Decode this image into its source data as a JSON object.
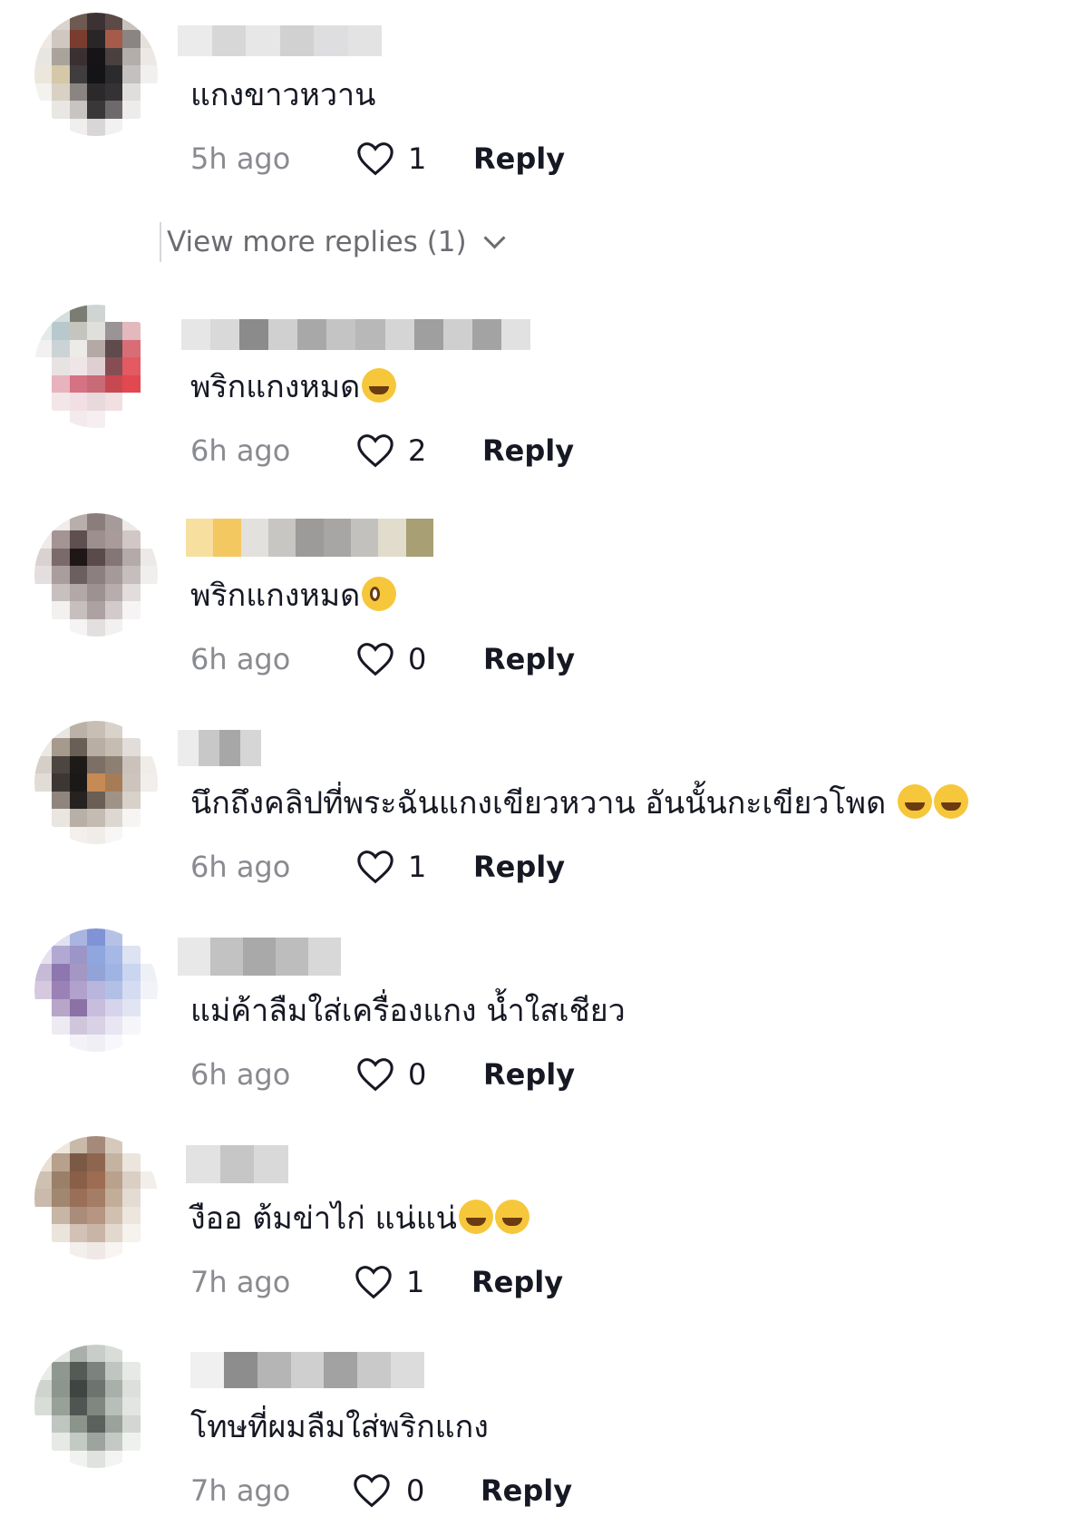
{
  "comments": [
    {
      "text": "แกงขาวหวาน",
      "emojis": [],
      "time": "5h ago",
      "likes": "1",
      "reply_label": "Reply",
      "avatar_colors": [
        "#ffffff",
        "#d9d4cf",
        "#6d5b52",
        "#3d3233",
        "#5b4a48",
        "#c8c2bc",
        "#ffffff",
        "#efe9e5",
        "#cfc7c0",
        "#7a3c2f",
        "#2a2526",
        "#a65b4a",
        "#8a8483",
        "#e4e0dc",
        "#e7e6e1",
        "#a9a39b",
        "#3a3031",
        "#161416",
        "#49403f",
        "#b3aeaa",
        "#ece8e5",
        "#ece7dc",
        "#d4c8a9",
        "#3f3d3e",
        "#141315",
        "#2b2a2c",
        "#c4c0bf",
        "#f2f0ef",
        "#f4f2ee",
        "#d9d1c4",
        "#8b8582",
        "#2b2929",
        "#343234",
        "#e0dddd",
        "#ffffff",
        "#ffffff",
        "#e9e7e4",
        "#c8c4c2",
        "#3a3739",
        "#6e6a6c",
        "#eeeceb",
        "#ffffff",
        "#ffffff",
        "#ffffff",
        "#f0efee",
        "#d8d6d7",
        "#f2f1f1",
        "#ffffff",
        "#ffffff"
      ]
    },
    {
      "text": "พริกแกงหมด",
      "emojis": [
        "laugh"
      ],
      "time": "6h ago",
      "likes": "2",
      "reply_label": "Reply",
      "avatar_colors": [
        "#ffffff",
        "#d6dfdd",
        "#7c7d72",
        "#cfd5d3",
        "#ffffff",
        "#ffffff",
        "#ffffff",
        "#e3eaea",
        "#b8c9cd",
        "#c5c5bf",
        "#dfe0dc",
        "#9a9497",
        "#e3b9bd",
        "#ffffff",
        "#f3f1f0",
        "#cbd3d6",
        "#ecebe8",
        "#b5a9a6",
        "#5f4a4c",
        "#d96d76",
        "#ffffff",
        "#ffffff",
        "#e6e3e2",
        "#f0e5e6",
        "#e0cfd2",
        "#864e54",
        "#e35a63",
        "#ffffff",
        "#ffffff",
        "#e8b3bd",
        "#d57283",
        "#c96a77",
        "#c84852",
        "#e2484f",
        "#ffffff",
        "#ffffff",
        "#f3e6e8",
        "#f2dfe3",
        "#e8d9dc",
        "#f1dfe1",
        "#ffffff",
        "#ffffff",
        "#ffffff",
        "#ffffff",
        "#f3eaec",
        "#f6eef0",
        "#ffffff",
        "#ffffff",
        "#ffffff"
      ]
    },
    {
      "text": "พริกแกงหมด",
      "emojis": [
        "plead"
      ],
      "time": "6h ago",
      "likes": "0",
      "reply_label": "Reply",
      "avatar_colors": [
        "#ffffff",
        "#efeceb",
        "#b8aeac",
        "#8b7d7c",
        "#a69b9a",
        "#ece9e8",
        "#ffffff",
        "#eeebea",
        "#a49594",
        "#5e4f50",
        "#9e8f8f",
        "#a89b9a",
        "#d0c7c6",
        "#ffffff",
        "#d9d2d1",
        "#7a6a6b",
        "#1e1617",
        "#5a4a4b",
        "#847676",
        "#b3aaa9",
        "#ece9e8",
        "#e4dfde",
        "#a99e9d",
        "#6c5f60",
        "#8b7f7f",
        "#a5999a",
        "#c6bebe",
        "#f1eeee",
        "#ffffff",
        "#c8bfbf",
        "#b3a8a8",
        "#9d9192",
        "#b7adad",
        "#e2dcdc",
        "#ffffff",
        "#ffffff",
        "#f3f0f0",
        "#c7bebe",
        "#ada2a3",
        "#d3cbcb",
        "#f6f4f4",
        "#ffffff",
        "#ffffff",
        "#ffffff",
        "#f5f3f3",
        "#e4dfdf",
        "#f3f0f0",
        "#ffffff",
        "#ffffff"
      ]
    },
    {
      "text": "นึกถึงคลิปที่พระฉันแกงเขียวหวาน อันนั้นกะเขียวโพด ",
      "emojis": [
        "laugh",
        "grin"
      ],
      "time": "6h ago",
      "likes": "1",
      "reply_label": "Reply",
      "avatar_colors": [
        "#ffffff",
        "#e9e5e0",
        "#bbb1a6",
        "#c8bfb4",
        "#d9d2cb",
        "#ffffff",
        "#ffffff",
        "#ece8e3",
        "#a69a8c",
        "#6a5f56",
        "#b9aea3",
        "#c6bcb2",
        "#e2ddd8",
        "#ffffff",
        "#d6cfc8",
        "#4d4540",
        "#1e1a18",
        "#7b6f66",
        "#8d7f72",
        "#cbc3bb",
        "#f0ede9",
        "#e2dcd6",
        "#3d3733",
        "#1b1918",
        "#c68a54",
        "#a67c57",
        "#cdc5bd",
        "#f1eeeb",
        "#ffffff",
        "#8f857d",
        "#262220",
        "#6a5e55",
        "#9f9387",
        "#d8d1ca",
        "#ffffff",
        "#ffffff",
        "#e9e5e1",
        "#b8afa6",
        "#c4bbb2",
        "#ddd7d1",
        "#f7f5f3",
        "#ffffff",
        "#ffffff",
        "#ffffff",
        "#f2efec",
        "#f0ede9",
        "#f8f6f4",
        "#ffffff",
        "#ffffff"
      ]
    },
    {
      "text": "แม่ค้าลืมใส่เครื่องแกง น้ำใสเชียว",
      "emojis": [],
      "time": "6h ago",
      "likes": "0",
      "reply_label": "Reply",
      "avatar_colors": [
        "#ffffff",
        "#dfe3f1",
        "#a9b5e0",
        "#7f93d6",
        "#b6c2e5",
        "#ffffff",
        "#ffffff",
        "#e6e0ee",
        "#b2a9d2",
        "#9c95c8",
        "#8fa7de",
        "#a5b8e6",
        "#dde3f2",
        "#ffffff",
        "#c6bad6",
        "#8d77ae",
        "#a497c4",
        "#92a3d8",
        "#9fb4e2",
        "#cad5ef",
        "#eef0f8",
        "#d6c9df",
        "#9b82b6",
        "#b2a1cc",
        "#b9b6dd",
        "#b3c0e5",
        "#d5dcf1",
        "#f2f3f9",
        "#ffffff",
        "#b7a6c8",
        "#8a72a7",
        "#c8bddc",
        "#d6d4ea",
        "#e1e5f3",
        "#ffffff",
        "#ffffff",
        "#eeeaf2",
        "#cfc6dc",
        "#d9d2e6",
        "#e8e6f2",
        "#f6f6fa",
        "#ffffff",
        "#ffffff",
        "#ffffff",
        "#f4f2f7",
        "#f1eff6",
        "#f8f7fb",
        "#ffffff",
        "#ffffff"
      ]
    },
    {
      "text": "งืออ ต้มข่าไก่ แน่แน่",
      "emojis": [
        "laugh",
        "laugh"
      ],
      "time": "7h ago",
      "likes": "1",
      "reply_label": "Reply",
      "avatar_colors": [
        "#ffffff",
        "#ede7e0",
        "#c9b9a9",
        "#a5897a",
        "#d6c9bc",
        "#ffffff",
        "#ffffff",
        "#e9e0d5",
        "#b7a08c",
        "#7b5a45",
        "#8e6650",
        "#c5b3a1",
        "#ebe5dd",
        "#ffffff",
        "#cfc1b2",
        "#9a8068",
        "#8a5f47",
        "#9e6c53",
        "#b9a18b",
        "#d9cfc4",
        "#f2eee9",
        "#c9baab",
        "#a28770",
        "#9a6f58",
        "#a57c65",
        "#c2ad98",
        "#e4dbd2",
        "#ffffff",
        "#ffffff",
        "#c7b6a6",
        "#a98c7a",
        "#b69582",
        "#d1c0b0",
        "#ece6df",
        "#ffffff",
        "#ffffff",
        "#ebe4dd",
        "#d1c2b5",
        "#c9b5a7",
        "#e3d8ce",
        "#f6f2ee",
        "#ffffff",
        "#ffffff",
        "#ffffff",
        "#f3efec",
        "#efe8e4",
        "#f7f4f2",
        "#ffffff",
        "#ffffff"
      ]
    },
    {
      "text": "โทษที่ผมลืมใส่พริกแกง",
      "emojis": [],
      "time": "7h ago",
      "likes": "0",
      "reply_label": "Reply",
      "avatar_colors": [
        "#ffffff",
        "#e4e6e3",
        "#a9afa9",
        "#c8cdc9",
        "#dadcd8",
        "#ffffff",
        "#ffffff",
        "#e8ebe8",
        "#8f9890",
        "#545b57",
        "#7c837e",
        "#c0c5c1",
        "#e7e9e6",
        "#ffffff",
        "#cfd4cf",
        "#8d968e",
        "#3f4542",
        "#6d7470",
        "#a9b0aa",
        "#dcdfdb",
        "#ffffff",
        "#d8ddd8",
        "#97a197",
        "#4e5652",
        "#7f8781",
        "#b8beb9",
        "#e2e5e1",
        "#ffffff",
        "#ffffff",
        "#bfc6bf",
        "#8a948b",
        "#5b625e",
        "#9ba29c",
        "#d3d7d3",
        "#ffffff",
        "#ffffff",
        "#e6e9e6",
        "#c3c9c3",
        "#9da39e",
        "#c4c9c5",
        "#eff1ef",
        "#ffffff",
        "#ffffff",
        "#ffffff",
        "#f1f3f1",
        "#dfe2df",
        "#f2f3f2",
        "#ffffff",
        "#ffffff"
      ]
    }
  ],
  "view_more": {
    "label": "View more replies (1)"
  }
}
